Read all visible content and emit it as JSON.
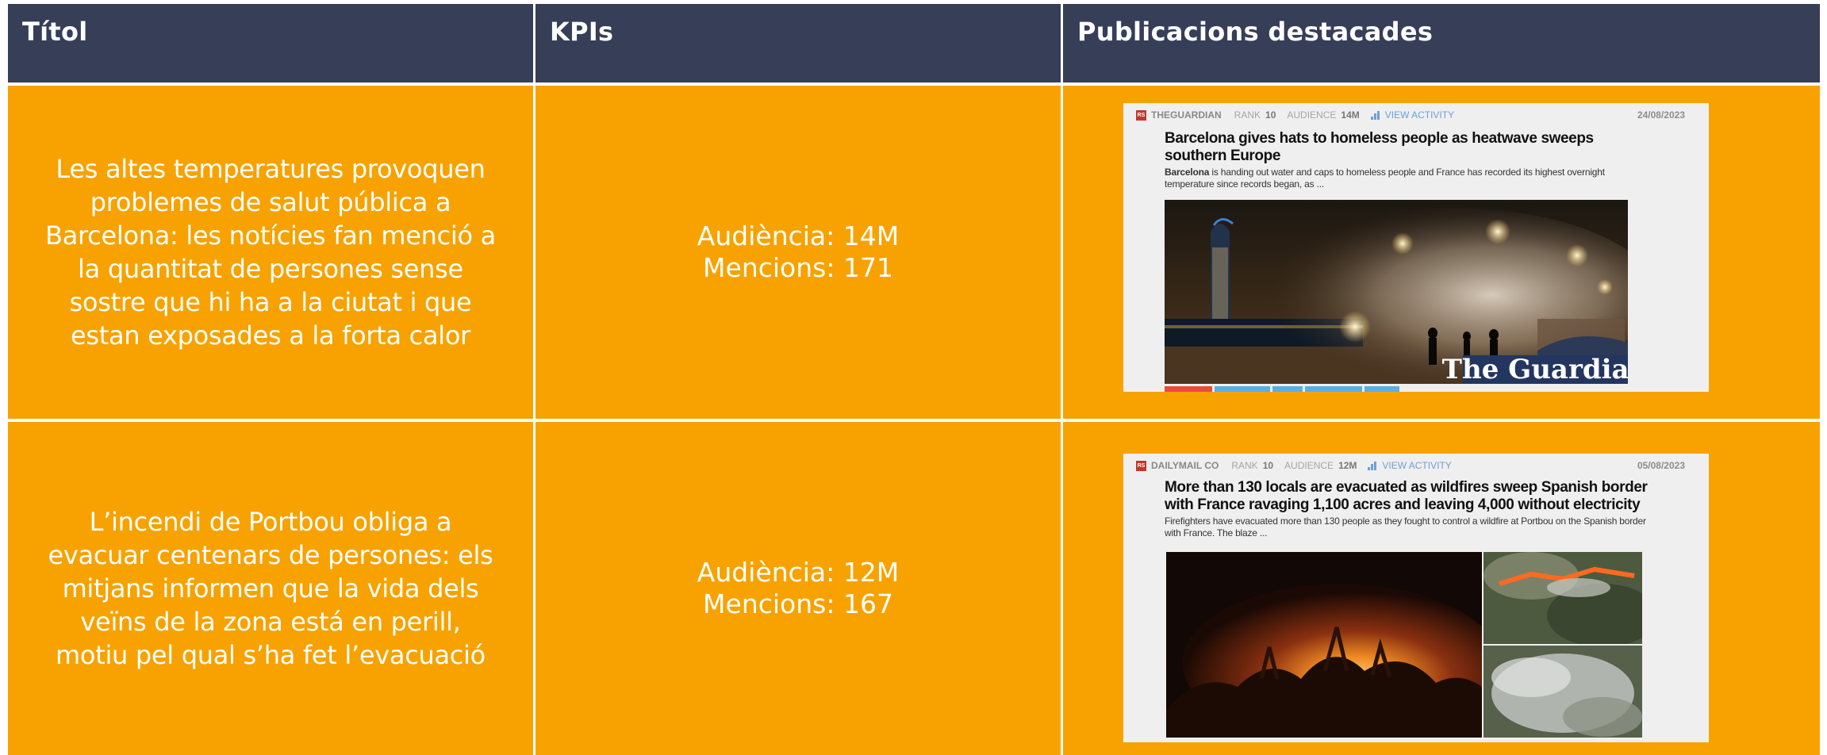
{
  "headers": {
    "col_title": "Títol",
    "col_kpis": "KPIs",
    "col_pubs": "Publicacions destacades"
  },
  "rows": [
    {
      "title": "Les altes temperatures provoquen\nproblemes de salut pública a\nBarcelona: les notícies fan menció a\nla quantitat de persones sense\nsostre que hi ha a la ciutat i que\nestan exposades a la forta calor",
      "kpi_audience": "Audiència: 14M",
      "kpi_mentions": "Mencions: 171",
      "pub": {
        "source_icon": "RS",
        "source": "THEGUARDIAN",
        "rank_label": "RANK",
        "rank_value": "10",
        "audience_label": "AUDIENCE",
        "audience_value": "14M",
        "activity": "VIEW ACTIVITY",
        "date": "24/08/2023",
        "headline": "Barcelona gives hats to homeless people as heatwave sweeps southern Europe",
        "snippet_bold": "Barcelona",
        "snippet": " is handing out water and caps to homeless people and France has recorded its highest overnight temperature since records began, as ...",
        "image_caption": "The Guardian"
      }
    },
    {
      "title": "L’incendi de Portbou obliga a\nevacuar centenars de persones: els\nmitjans informen que la vida dels\nveïns de la zona está en perill,\nmotiu pel qual s’ha fet l’evacuació",
      "kpi_audience": "Audiència: 12M",
      "kpi_mentions": "Mencions: 167",
      "pub": {
        "source_icon": "RS",
        "source": "DAILYMAIL CO",
        "rank_label": "RANK",
        "rank_value": "10",
        "audience_label": "AUDIENCE",
        "audience_value": "12M",
        "activity": "VIEW ACTIVITY",
        "date": "05/08/2023",
        "headline": "More than 130 locals are evacuated as wildfires sweep Spanish border with France ravaging 1,100 acres and leaving 4,000 without electricity",
        "snippet": "Firefighters have evacuated more than 130 people as they fought to control a wildfire at Portbou on the Spanish border with France. The blaze ..."
      }
    }
  ],
  "colors": {
    "header_bg": "#363e58",
    "cell_bg": "#f7a200",
    "text": "#ffffff",
    "card_bg": "#efefef",
    "activity_link": "#6d9fd8"
  }
}
